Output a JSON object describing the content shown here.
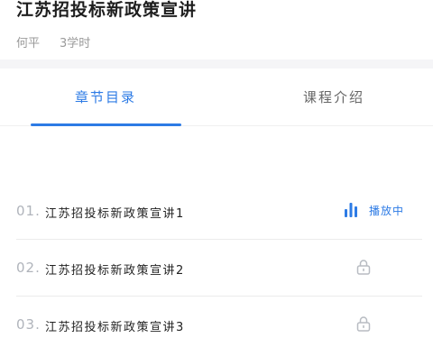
{
  "course": {
    "title": "江苏招投标新政策宣讲",
    "teacher": "何平",
    "hours": "3学时"
  },
  "tabs": [
    {
      "label": "章节目录",
      "active": true
    },
    {
      "label": "课程介绍",
      "active": false
    }
  ],
  "chapters": [
    {
      "index": "01.",
      "title": "江苏招投标新政策宣讲1",
      "status": "playing",
      "status_label": "播放中",
      "status_icon": "equalizer-bars-icon"
    },
    {
      "index": "02.",
      "title": "江苏招投标新政策宣讲2",
      "status": "locked",
      "status_icon": "lock-icon"
    },
    {
      "index": "03.",
      "title": "江苏招投标新政策宣讲3",
      "status": "locked",
      "status_icon": "lock-icon"
    }
  ],
  "colors": {
    "accent": "#2d7be5",
    "muted": "#b0b4bb",
    "divider_band": "#f5f5f7"
  }
}
